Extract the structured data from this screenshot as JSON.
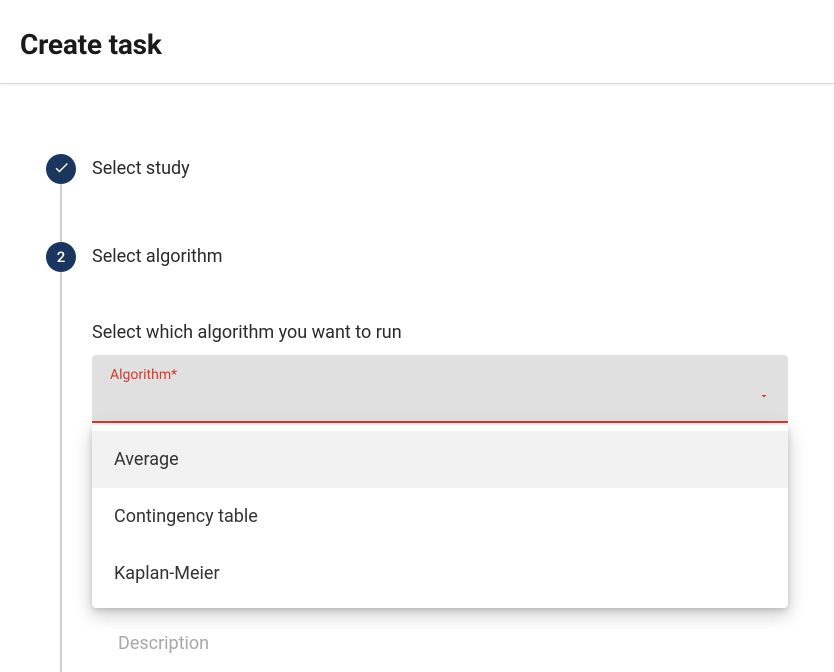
{
  "header": {
    "title": "Create task"
  },
  "steps": {
    "step1": {
      "label": "Select study"
    },
    "step2": {
      "number": "2",
      "label": "Select algorithm",
      "intro": "Select which algorithm you want to run",
      "field_label": "Algorithm*",
      "options": [
        "Average",
        "Contingency table",
        "Kaplan-Meier"
      ],
      "behind_label": "Description"
    }
  }
}
